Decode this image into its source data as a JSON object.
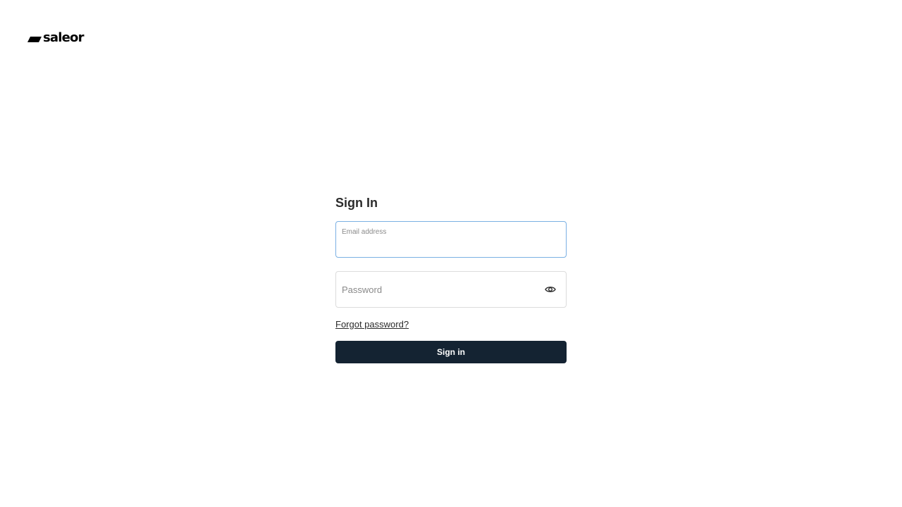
{
  "brand": {
    "name": "saleor",
    "logo_icon": "saleor-slash-icon",
    "color": "#000000"
  },
  "form": {
    "title": "Sign In",
    "email": {
      "label": "Email address",
      "value": "",
      "focused": true,
      "focus_color": "#7ab0e3"
    },
    "password": {
      "placeholder": "Password",
      "value": "",
      "toggle_icon": "eye-icon"
    },
    "forgot_link": "Forgot password?",
    "submit_label": "Sign in",
    "submit_color": "#142332"
  }
}
